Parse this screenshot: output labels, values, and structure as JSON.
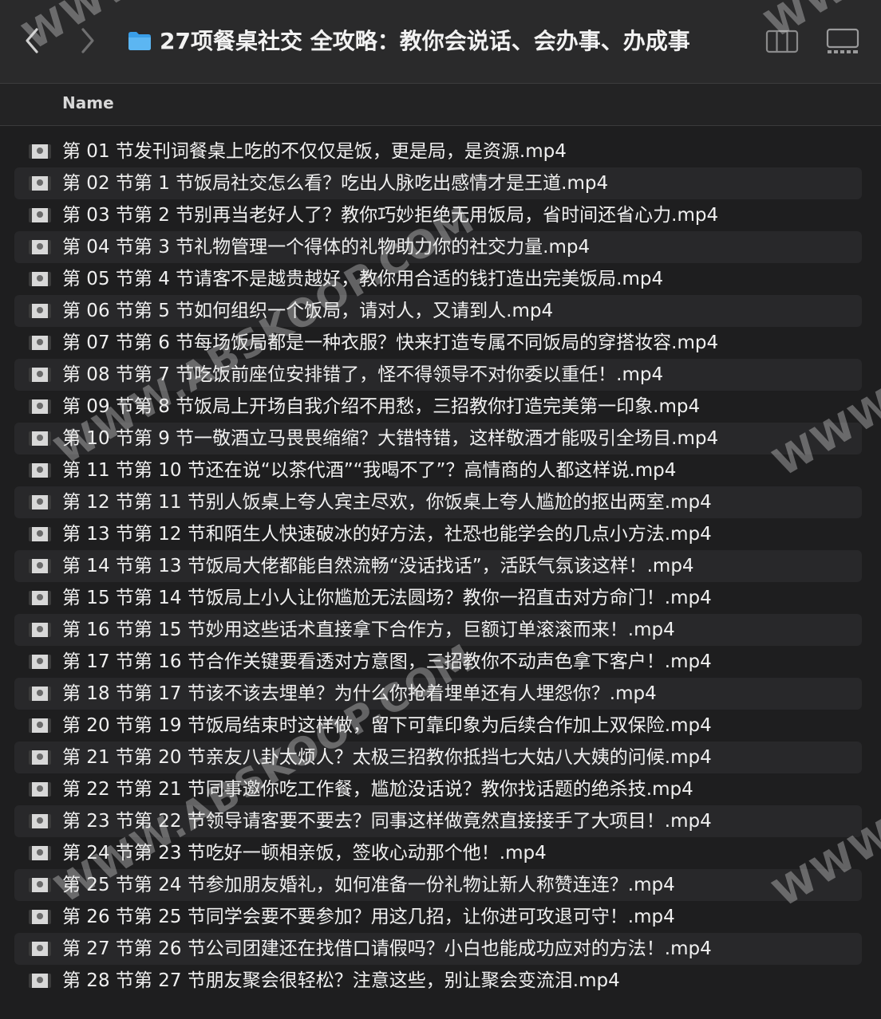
{
  "toolbar": {
    "title": "27项餐桌社交 全攻略：教你会说话、会办事、办成事",
    "back_icon": "chevron-left-icon",
    "forward_icon": "chevron-right-icon",
    "folder_icon": "folder-icon",
    "columns_view_icon": "columns-view-icon",
    "gallery_view_icon": "gallery-view-icon"
  },
  "header": {
    "name_label": "Name"
  },
  "files": [
    "第 01 节发刊词餐桌上吃的不仅仅是饭，更是局，是资源.mp4",
    "第 02 节第 1 节饭局社交怎么看？吃出人脉吃出感情才是王道.mp4",
    "第 03 节第 2 节别再当老好人了？教你巧妙拒绝无用饭局，省时间还省心力.mp4",
    "第 04 节第 3 节礼物管理一个得体的礼物助力你的社交力量.mp4",
    "第 05 节第 4 节请客不是越贵越好，教你用合适的钱打造出完美饭局.mp4",
    "第 06 节第 5 节如何组织一个饭局，请对人，又请到人.mp4",
    "第 07 节第 6 节每场饭局都是一种衣服？快来打造专属不同饭局的穿搭妆容.mp4",
    "第 08 节第 7 节吃饭前座位安排错了，怪不得领导不对你委以重任！.mp4",
    "第 09 节第 8 节饭局上开场自我介绍不用愁，三招教你打造完美第一印象.mp4",
    "第 10 节第 9 节一敬酒立马畏畏缩缩？大错特错，这样敬酒才能吸引全场目.mp4",
    "第 11 节第 10 节还在说“以茶代酒”“我喝不了”？高情商的人都这样说.mp4",
    "第 12 节第 11 节别人饭桌上夸人宾主尽欢，你饭桌上夸人尴尬的抠出两室.mp4",
    "第 13 节第 12 节和陌生人快速破冰的好方法，社恐也能学会的几点小方法.mp4",
    "第 14 节第 13 节饭局大佬都能自然流畅“没话找话”，活跃气氛该这样！.mp4",
    "第 15 节第 14 节饭局上小人让你尴尬无法圆场？教你一招直击对方命门！.mp4",
    "第 16 节第 15 节妙用这些话术直接拿下合作方，巨额订单滚滚而来！.mp4",
    "第 17 节第 16 节合作关键要看透对方意图，三招教你不动声色拿下客户！.mp4",
    "第 18 节第 17 节该不该去埋单？为什么你抢着埋单还有人埋怨你？.mp4",
    "第 20 节第 19 节饭局结束时这样做，留下可靠印象为后续合作加上双保险.mp4",
    "第 21 节第 20 节亲友八卦太烦人？太极三招教你抵挡七大姑八大姨的问候.mp4",
    "第 22 节第 21 节同事邀你吃工作餐，尴尬没话说？教你找话题的绝杀技.mp4",
    "第 23 节第 22 节领导请客要不要去？同事这样做竟然直接接手了大项目！.mp4",
    "第 24 节第 23 节吃好一顿相亲饭，签收心动那个他！.mp4",
    "第 25 节第 24 节参加朋友婚礼，如何准备一份礼物让新人称赞连连？.mp4",
    "第 26 节第 25 节同学会要不要参加？用这几招，让你进可攻退可守！.mp4",
    "第 27 节第 26 节公司团建还在找借口请假吗？小白也能成功应对的方法！.mp4",
    "第 28 节第 27 节朋友聚会很轻松？注意这些，别让聚会变流泪.mp4"
  ],
  "watermarks": [
    "WWW.ABSKOOP.COM",
    "WWW.ABSKOOP.COM",
    "WWW.A",
    "WWW.A",
    "WWW.A"
  ]
}
